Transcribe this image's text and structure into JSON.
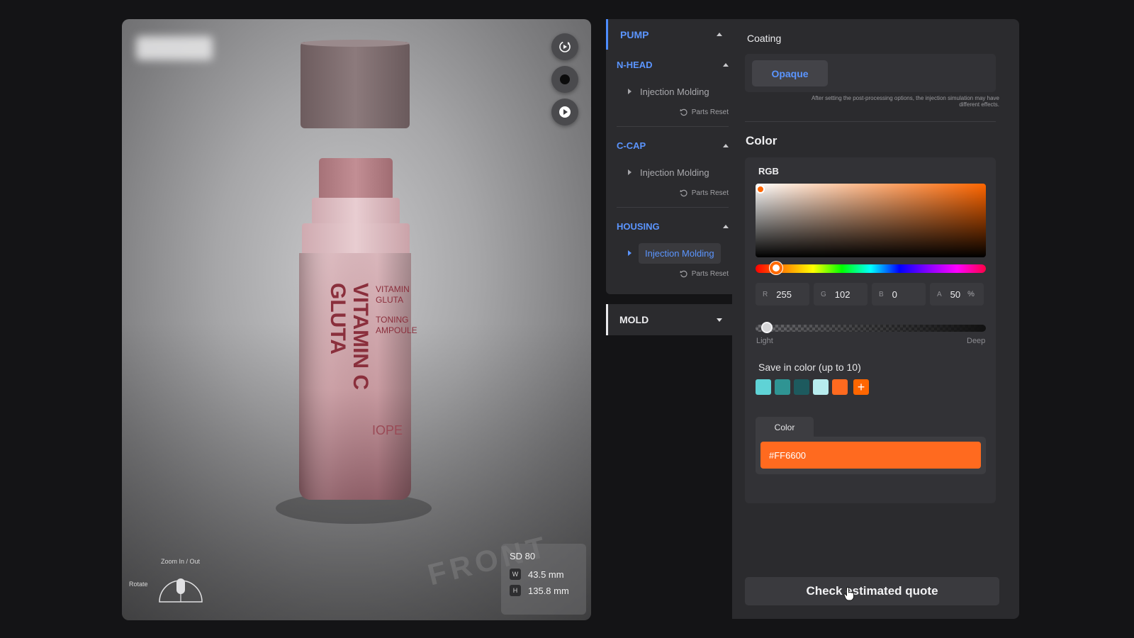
{
  "viewer": {
    "controls": [
      {
        "name": "rotate-view-button",
        "icon": "rotate-icon"
      },
      {
        "name": "material-toggle-button",
        "icon": "filled-circle-icon"
      },
      {
        "name": "play-button",
        "icon": "play-icon"
      }
    ],
    "product": {
      "label_main_1": "GLUTA",
      "label_main_2": "VITAMIN C",
      "label_side_1": "VITAMIN",
      "label_side_2": "GLUTA",
      "label_side_3": "TONING",
      "label_side_4": "AMPOULE",
      "label_brand": "IOPE"
    },
    "front_marker": "FRONT",
    "dimensions": {
      "model": "SD 80",
      "width_tag": "W",
      "width": "43.5 mm",
      "height_tag": "H",
      "height": "135.8 mm"
    },
    "nav": {
      "zoom_label": "Zoom In / Out",
      "rotate_label": "Rotate"
    }
  },
  "tree": {
    "header": "PUMP",
    "sections": [
      {
        "title": "N-HEAD",
        "item": "Injection Molding",
        "reset": "Parts Reset",
        "active": false
      },
      {
        "title": "C-CAP",
        "item": "Injection Molding",
        "reset": "Parts Reset",
        "active": false
      },
      {
        "title": "HOUSING",
        "item": "Injection Molding",
        "reset": "Parts Reset",
        "active": true
      }
    ],
    "mold": "MOLD"
  },
  "panel": {
    "coating_title": "Coating",
    "coating_option": "Opaque",
    "coating_note": "After setting the post-processing options, the injection simulation may have different effects.",
    "color_title": "Color",
    "color_mode": "RGB",
    "channels": {
      "r_label": "R",
      "r": "255",
      "g_label": "G",
      "g": "102",
      "b_label": "B",
      "b": "0",
      "a_label": "A",
      "a": "50",
      "a_unit": "%"
    },
    "shade_light": "Light",
    "shade_deep": "Deep",
    "save_label": "Save in color (up to 10)",
    "saved_colors": [
      "#5fd3d6",
      "#2f9493",
      "#1d5a5e",
      "#b7ecee",
      "#ff6a1f"
    ],
    "add_color": "+",
    "color_tab": "Color",
    "hex_value": "#FF6600",
    "quote_button": "Check estimated quote"
  },
  "colors": {
    "accent": "#5b95ff",
    "selected": "#ff6600"
  }
}
